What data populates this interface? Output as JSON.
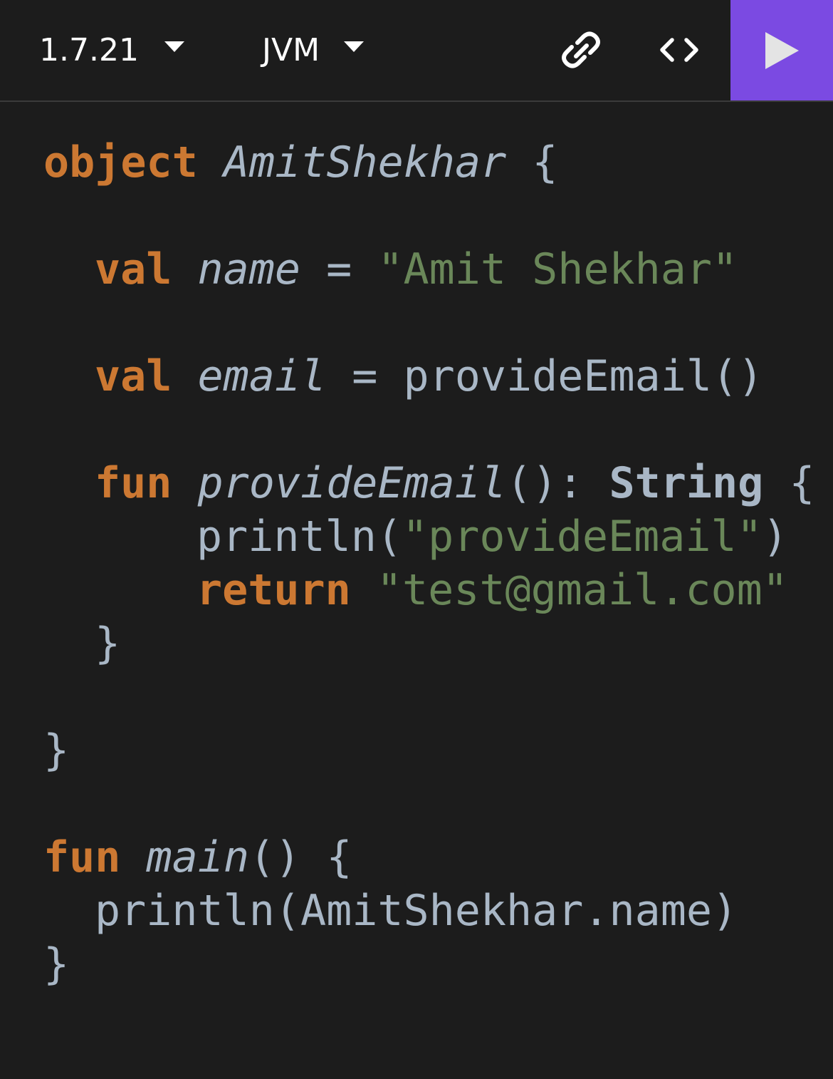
{
  "toolbar": {
    "version": "1.7.21",
    "target": "JVM",
    "link_icon": "link-icon",
    "embed_icon": "code-brackets-icon",
    "run_icon": "play-icon",
    "run_color": "#7b4ae2"
  },
  "colors": {
    "background": "#1c1c1c",
    "keyword": "#cc7832",
    "string": "#6a8759",
    "plain": "#a9b7c6"
  },
  "code": {
    "l1": {
      "kw": "object",
      "name": "AmitShekhar",
      "brace": "{"
    },
    "l2": {
      "kw": "val",
      "name": "name",
      "eq": "=",
      "str": "\"Amit Shekhar\""
    },
    "l3": {
      "kw": "val",
      "name": "email",
      "eq": "=",
      "call": "provideEmail()"
    },
    "l4": {
      "kw": "fun",
      "name": "provideEmail",
      "parens": "():",
      "type": "String",
      "brace": "{"
    },
    "l5": {
      "fn": "println(",
      "str": "\"provideEmail\"",
      "close": ")"
    },
    "l6": {
      "kw": "return",
      "str": "\"test@gmail.com\""
    },
    "l7": {
      "brace": "}"
    },
    "l8": {
      "brace": "}"
    },
    "l9": {
      "kw": "fun",
      "name": "main",
      "rest": "() {"
    },
    "l10": {
      "text": "println(AmitShekhar.name)"
    },
    "l11": {
      "brace": "}"
    }
  }
}
